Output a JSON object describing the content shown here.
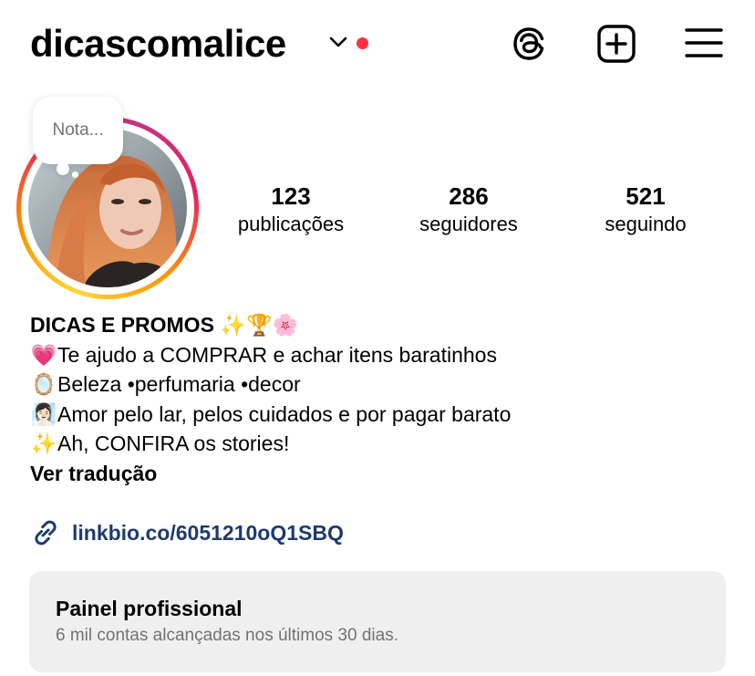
{
  "header": {
    "username": "dicascomalice",
    "has_notification": true,
    "notification_color": "#ff3040"
  },
  "icons": {
    "threads": "threads-icon",
    "new_post": "plus-square-icon",
    "menu": "hamburger-menu-icon"
  },
  "note": {
    "placeholder": "Nota..."
  },
  "stats": {
    "posts": {
      "count": "123",
      "label": "publicações"
    },
    "followers": {
      "count": "286",
      "label": "seguidores"
    },
    "following": {
      "count": "521",
      "label": "seguindo"
    }
  },
  "bio": {
    "name": "DICAS E PROMOS",
    "name_emojis": "✨🏆🌸",
    "lines": [
      {
        "emoji": "💗",
        "text": "Te ajudo a COMPRAR e achar itens baratinhos"
      },
      {
        "emoji": "🪞",
        "text": "Beleza •perfumaria •decor"
      },
      {
        "emoji": "🧖🏻‍♀️",
        "text": "Amor pelo lar, pelos cuidados e por pagar barato"
      },
      {
        "emoji": "✨",
        "text": "Ah, CONFIRA os stories!"
      }
    ],
    "translate_label": "Ver tradução"
  },
  "link": {
    "url": "linkbio.co/6051210oQ1SBQ",
    "icon": "link-icon"
  },
  "professional_panel": {
    "title": "Painel profissional",
    "subtitle": "6 mil contas alcançadas nos últimos 30 dias."
  },
  "colors": {
    "link_text": "#1e3a6e",
    "panel_bg": "#efefef",
    "secondary_text": "#737373"
  }
}
